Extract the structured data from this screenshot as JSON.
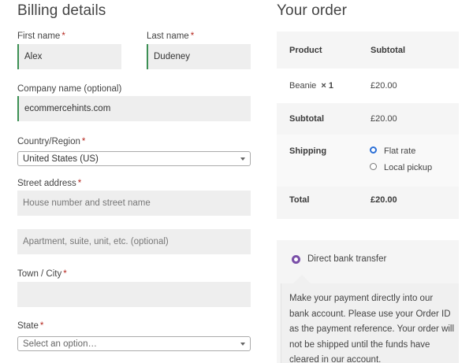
{
  "billing": {
    "title": "Billing details",
    "required_mark": "*",
    "first_name": {
      "label": "First name",
      "value": "Alex"
    },
    "last_name": {
      "label": "Last name",
      "value": "Dudeney"
    },
    "company": {
      "label": "Company name (optional)",
      "value": "ecommercehints.com"
    },
    "country": {
      "label": "Country/Region",
      "value": "United States (US)"
    },
    "street": {
      "label": "Street address",
      "placeholder1": "House number and street name",
      "placeholder2": "Apartment, suite, unit, etc. (optional)"
    },
    "city": {
      "label": "Town / City",
      "value": ""
    },
    "state": {
      "label": "State",
      "placeholder": "Select an option…"
    }
  },
  "order": {
    "title": "Your order",
    "header": {
      "product": "Product",
      "subtotal": "Subtotal"
    },
    "item": {
      "name": "Beanie",
      "qty": "× 1",
      "price": "£20.00"
    },
    "subtotal": {
      "label": "Subtotal",
      "value": "£20.00"
    },
    "shipping": {
      "label": "Shipping",
      "options": [
        {
          "label": "Flat rate",
          "selected": true
        },
        {
          "label": "Local pickup",
          "selected": false
        }
      ]
    },
    "total": {
      "label": "Total",
      "value": "£20.00"
    }
  },
  "payment": {
    "method": "Direct bank transfer",
    "description": "Make your payment directly into our bank account. Please use your Order ID as the payment reference. Your order will not be shipped until the funds have cleared in our account."
  }
}
